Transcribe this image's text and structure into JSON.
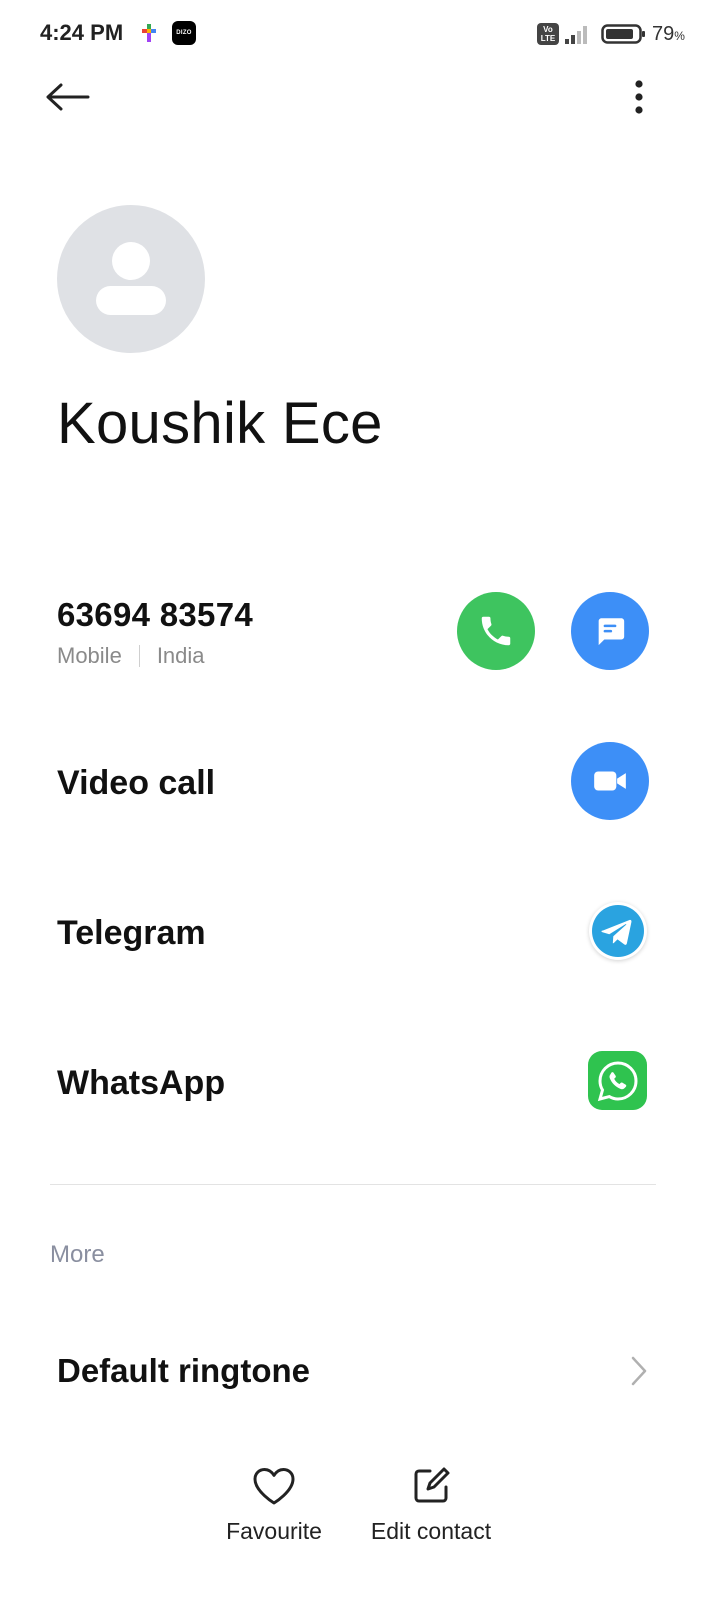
{
  "status_bar": {
    "time": "4:24 PM",
    "notification_icons": [
      "multicolor-app-icon",
      "dizo-app-icon"
    ],
    "dizo_text": "DIZO",
    "volte_text": "Vo LTE",
    "battery_percent": "79",
    "battery_unit": "%"
  },
  "toolbar": {
    "back_icon": "back-arrow-icon",
    "more_icon": "more-vertical-icon"
  },
  "contact": {
    "name": "Koushik Ece",
    "avatar_icon": "person-placeholder-icon"
  },
  "phone": {
    "number": "63694 83574",
    "type": "Mobile",
    "region": "India",
    "call_icon": "phone-icon",
    "message_icon": "message-icon"
  },
  "rows": {
    "video_call": "Video call",
    "telegram": "Telegram",
    "whatsapp": "WhatsApp"
  },
  "more": {
    "section_title": "More",
    "ringtone_label": "Default ringtone"
  },
  "bottom_actions": {
    "favourite": "Favourite",
    "edit_contact": "Edit contact"
  },
  "colors": {
    "call_green": "#3ec45f",
    "message_blue": "#3d8ff7",
    "telegram_blue": "#2aa3e0",
    "whatsapp_green": "#2fc34f",
    "avatar_grey": "#dfe1e5"
  }
}
